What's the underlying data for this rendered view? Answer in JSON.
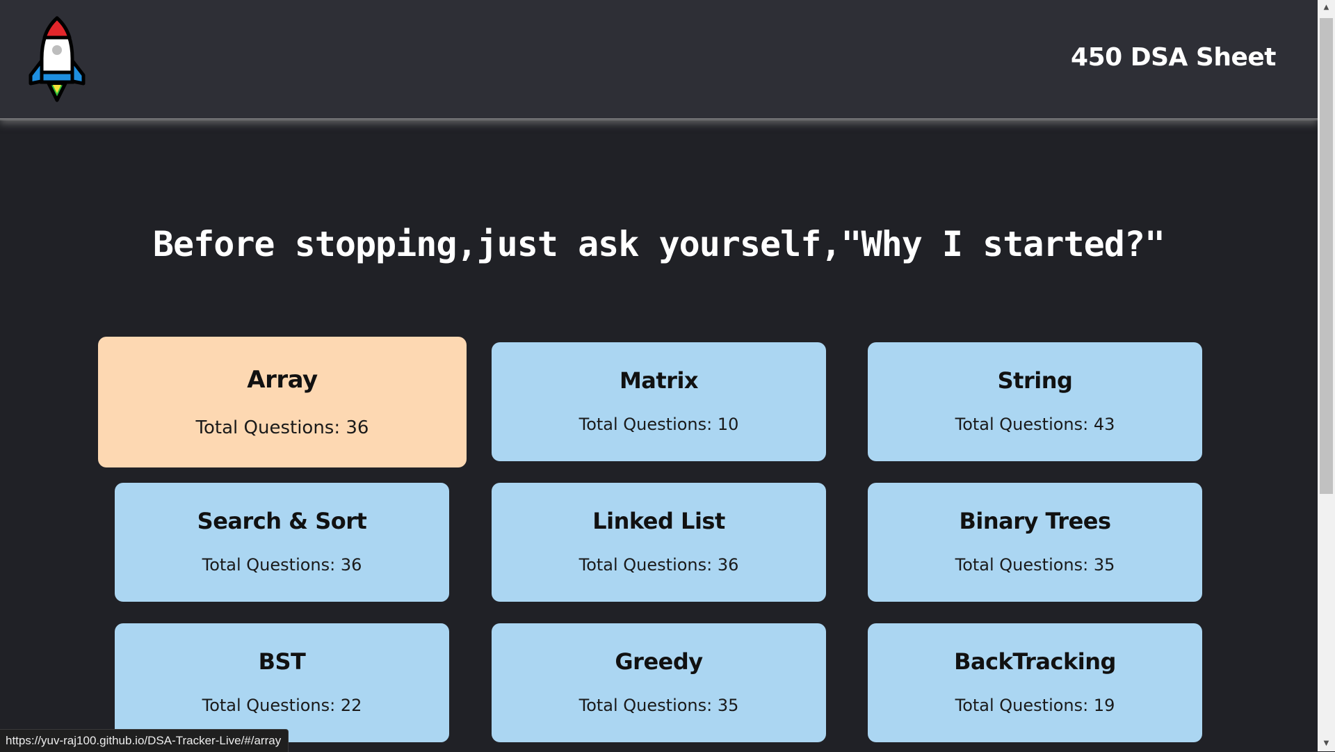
{
  "navbar": {
    "brand": "450 DSA Sheet",
    "logo_icon": "rocket-icon"
  },
  "quote": "Before stopping,just ask yourself,\"Why I started?\"",
  "topics": [
    {
      "title": "Array",
      "count_label": "Total Questions: 36",
      "active": true
    },
    {
      "title": "Matrix",
      "count_label": "Total Questions: 10",
      "active": false
    },
    {
      "title": "String",
      "count_label": "Total Questions: 43",
      "active": false
    },
    {
      "title": "Search & Sort",
      "count_label": "Total Questions: 36",
      "active": false
    },
    {
      "title": "Linked List",
      "count_label": "Total Questions: 36",
      "active": false
    },
    {
      "title": "Binary Trees",
      "count_label": "Total Questions: 35",
      "active": false
    },
    {
      "title": "BST",
      "count_label": "Total Questions: 22",
      "active": false
    },
    {
      "title": "Greedy",
      "count_label": "Total Questions: 35",
      "active": false
    },
    {
      "title": "BackTracking",
      "count_label": "Total Questions: 19",
      "active": false
    }
  ],
  "status_bar": {
    "url": "https://yuv-raj100.github.io/DSA-Tracker-Live/#/array"
  },
  "colors": {
    "background": "#202126",
    "navbar": "#2e2f36",
    "card": "#abd6f2",
    "card_hover": "#fdd8b2"
  }
}
